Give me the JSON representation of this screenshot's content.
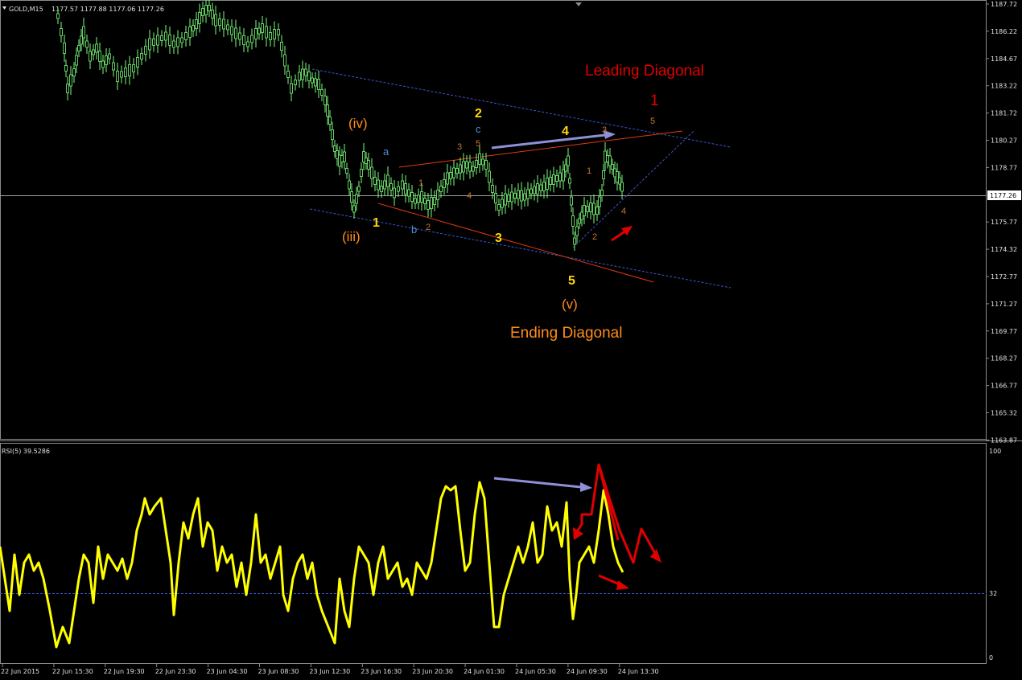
{
  "window": {
    "symbol": "GOLD,M15",
    "ohlc": "1177.57 1177.88 1177.06 1177.26",
    "last_price": "1177.26"
  },
  "price_axis": [
    "1187.72",
    "1186.22",
    "1184.67",
    "1183.22",
    "1181.72",
    "1180.27",
    "1178.77",
    "1177.26",
    "1175.77",
    "1174.32",
    "1172.77",
    "1171.27",
    "1169.77",
    "1168.27",
    "1166.77",
    "1165.32",
    "1163.87"
  ],
  "rsi_panel": {
    "title": "RSI(5) 39.5286",
    "levels": [
      "100",
      "32",
      "0"
    ]
  },
  "time_axis": [
    "22 Jun 2015",
    "22 Jun 15:30",
    "22 Jun 19:30",
    "22 Jun 23:30",
    "23 Jun 04:30",
    "23 Jun 08:30",
    "23 Jun 12:30",
    "23 Jun 16:30",
    "23 Jun 20:30",
    "24 Jun 01:30",
    "24 Jun 05:30",
    "24 Jun 09:30",
    "24 Jun 13:30"
  ],
  "annotations": {
    "leading_diagonal": "Leading Diagonal",
    "ending_diagonal": "Ending Diagonal",
    "wave_1_red": "1",
    "wave_iv": "(iv)",
    "wave_iii": "(iii)",
    "wave_v": "(v)",
    "wave_1": "1",
    "wave_2": "2",
    "wave_3": "3",
    "wave_4": "4",
    "wave_5": "5",
    "sub_a": "a",
    "sub_b": "b",
    "sub_c": "c",
    "minor_labels": [
      "1",
      "2",
      "3",
      "4",
      "5",
      "1",
      "2",
      "3",
      "4",
      "5"
    ]
  },
  "colors": {
    "background": "#000000",
    "candle": "#7cfc7c",
    "rsi_line": "#ffff00",
    "red": "#e00000",
    "orange": "#ff8c1a",
    "gold": "#ffd700",
    "blue": "#4f8fd6",
    "trend_blue": "#3a55d0",
    "trend_red": "#e03a10",
    "arrow_lavender": "#8f8fd8",
    "axis_text": "#e0e0e0"
  }
}
